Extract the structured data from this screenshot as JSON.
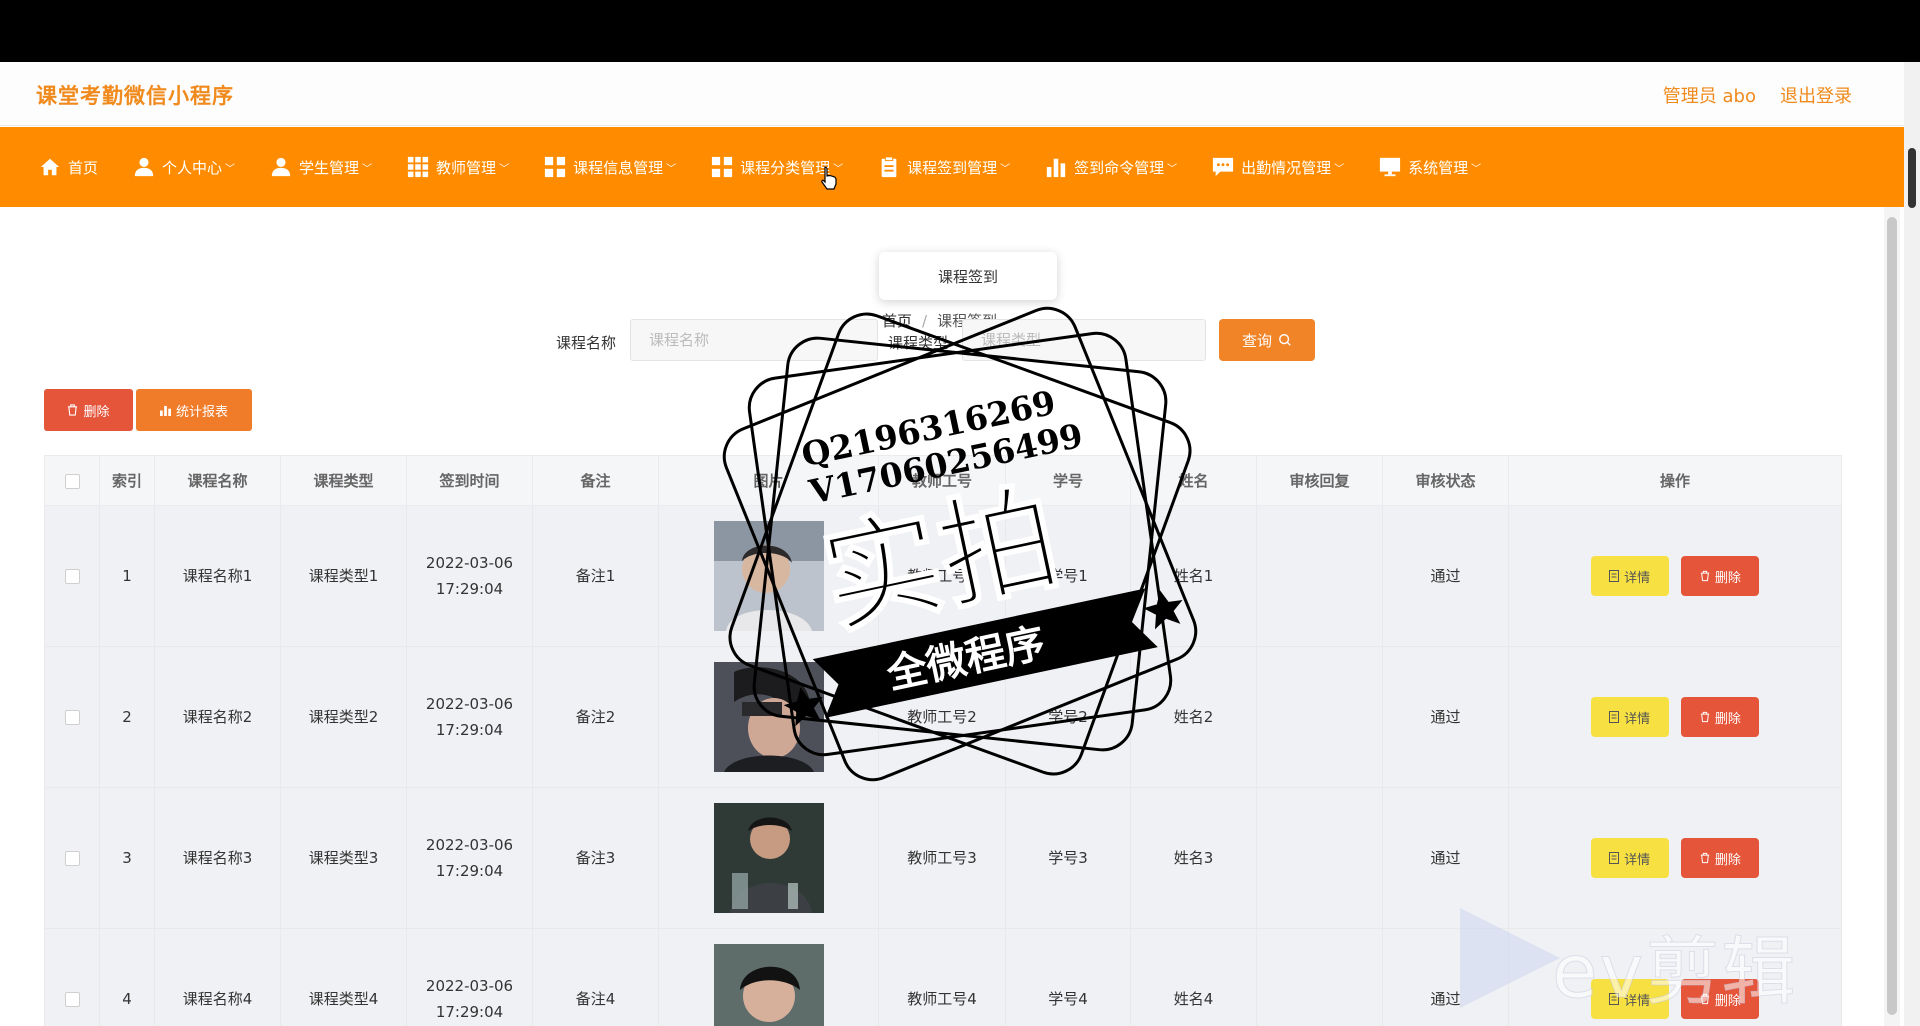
{
  "header": {
    "title": "课堂考勤微信小程序",
    "user": "管理员 abo",
    "logout": "退出登录"
  },
  "nav": [
    {
      "label": "首页",
      "icon": "home-icon",
      "caret": false
    },
    {
      "label": "个人中心",
      "icon": "user-icon",
      "caret": true
    },
    {
      "label": "学生管理",
      "icon": "user-icon",
      "caret": true
    },
    {
      "label": "教师管理",
      "icon": "grid-icon",
      "caret": true
    },
    {
      "label": "课程信息管理",
      "icon": "apps-icon",
      "caret": true
    },
    {
      "label": "课程分类管理",
      "icon": "apps-icon",
      "caret": true
    },
    {
      "label": "课程签到管理",
      "icon": "clipboard-icon",
      "caret": true
    },
    {
      "label": "签到命令管理",
      "icon": "bar-chart-icon",
      "caret": true
    },
    {
      "label": "出勤情况管理",
      "icon": "chat-icon",
      "caret": true
    },
    {
      "label": "系统管理",
      "icon": "monitor-icon",
      "caret": true
    }
  ],
  "dropdown": {
    "item": "课程签到"
  },
  "breadcrumb": {
    "home": "首页",
    "sep": "/",
    "current": "课程签到"
  },
  "search": {
    "name_label": "课程名称",
    "name_placeholder": "课程名称",
    "type_label": "课程类型",
    "type_placeholder": "课程类型",
    "button": "查询"
  },
  "actions": {
    "delete": "删除",
    "report": "统计报表"
  },
  "table": {
    "columns": [
      "索引",
      "课程名称",
      "课程类型",
      "签到时间",
      "备注",
      "图片",
      "教师工号",
      "学号",
      "姓名",
      "审核回复",
      "审核状态",
      "操作"
    ],
    "rows": [
      {
        "index": "1",
        "name": "课程名称1",
        "type": "课程类型1",
        "time": "2022-03-06 17:29:04",
        "remark": "备注1",
        "teacher": "教师工号1",
        "student": "学号1",
        "realname": "姓名1",
        "reply": "",
        "status": "通过"
      },
      {
        "index": "2",
        "name": "课程名称2",
        "type": "课程类型2",
        "time": "2022-03-06 17:29:04",
        "remark": "备注2",
        "teacher": "教师工号2",
        "student": "学号2",
        "realname": "姓名2",
        "reply": "",
        "status": "通过"
      },
      {
        "index": "3",
        "name": "课程名称3",
        "type": "课程类型3",
        "time": "2022-03-06 17:29:04",
        "remark": "备注3",
        "teacher": "教师工号3",
        "student": "学号3",
        "realname": "姓名3",
        "reply": "",
        "status": "通过"
      },
      {
        "index": "4",
        "name": "课程名称4",
        "type": "课程类型4",
        "time": "2022-03-06 17:29:04",
        "remark": "备注4",
        "teacher": "教师工号4",
        "student": "学号4",
        "realname": "姓名4",
        "reply": "",
        "status": "通过"
      }
    ],
    "detail_btn": "详情",
    "delete_btn": "删除"
  },
  "watermark": {
    "line1": "Q2196316269",
    "line2": "V17060256499",
    "main": "实拍",
    "ribbon": "全微程序",
    "ev": "ev剪辑"
  },
  "colors": {
    "accent": "#ff8c00",
    "title": "#f08a1c",
    "danger": "#e4553a",
    "warning": "#f7e042"
  }
}
